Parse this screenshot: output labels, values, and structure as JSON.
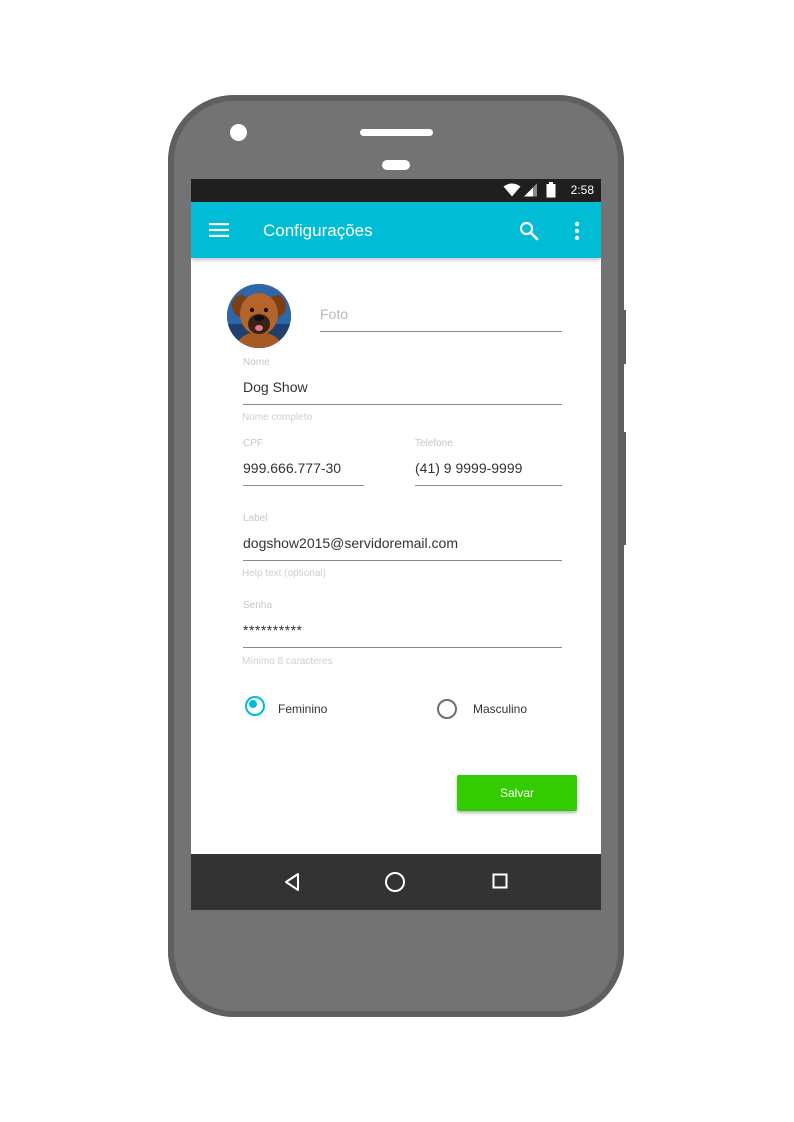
{
  "status_bar": {
    "time": "2:58"
  },
  "app_bar": {
    "title": "Configurações",
    "icons": [
      "menu-icon",
      "search-icon",
      "more-vert-icon"
    ]
  },
  "form": {
    "photo": {
      "placeholder": "Foto"
    },
    "name": {
      "label": "Nome",
      "value": "Dog Show",
      "helper": "Nome completo"
    },
    "cpf": {
      "label": "CPF",
      "value": "999.666.777-30"
    },
    "phone": {
      "label": "Telefone",
      "value": "(41) 9 9999-9999"
    },
    "email": {
      "label": "Label",
      "value": "dogshow2015@servidoremail.com",
      "helper": "Help text (optional)"
    },
    "password": {
      "label": "Senha",
      "value": "**********",
      "helper": "Mínimo 8 caracteres"
    },
    "gender": {
      "options": [
        "Feminino",
        "Masculino"
      ],
      "selected": "Feminino"
    },
    "save_label": "Salvar"
  },
  "nav_bar": {
    "icons": [
      "back-icon",
      "home-icon",
      "recents-icon"
    ]
  },
  "colors": {
    "primary": "#00bcd4",
    "accent_button": "#33cc00",
    "status_bar": "#1f1f1f",
    "nav_bar": "#333333",
    "phone_body": "#737373"
  }
}
